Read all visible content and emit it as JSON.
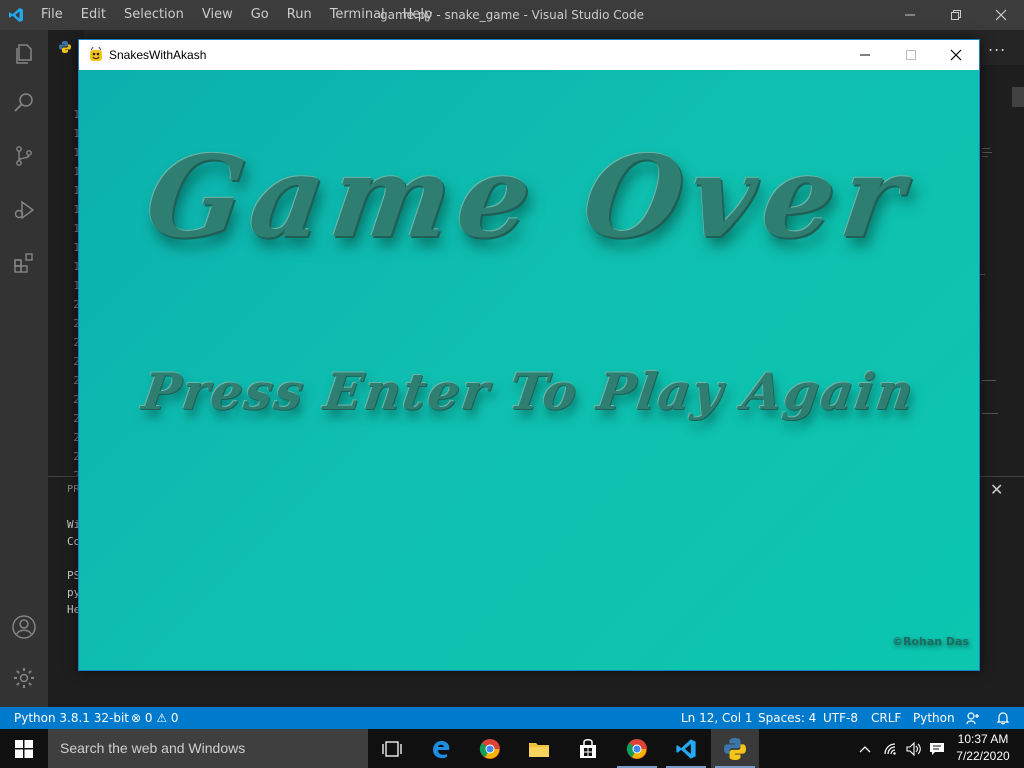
{
  "vscode": {
    "title": "game.py - snake_game - Visual Studio Code",
    "menu": [
      "File",
      "Edit",
      "Selection",
      "View",
      "Go",
      "Run",
      "Terminal",
      "Help"
    ],
    "more_actions": "...",
    "line_numbers": [
      "1",
      "1",
      "1",
      "1",
      "1",
      "1",
      "1",
      "1",
      "1",
      "1",
      "2",
      "2",
      "2",
      "2",
      "2",
      "2",
      "2",
      "2",
      "2",
      "2"
    ],
    "panel_tab_label": "PR",
    "terminal_lines": [
      "Wi",
      "Co",
      "PS",
      "py",
      "He"
    ]
  },
  "status_bar": {
    "interpreter": "Python 3.8.1 32-bit",
    "problems": "⊗ 0 ⚠ 0",
    "position": "Ln 12, Col 1",
    "spaces": "Spaces: 4",
    "encoding": "UTF-8",
    "eol": "CRLF",
    "language": "Python"
  },
  "game_window": {
    "title": "SnakesWithAkash",
    "headline": "Game Over",
    "subline": "Press Enter To Play Again",
    "credit": "©Rohan Das"
  },
  "taskbar": {
    "search_placeholder": "Search the web and Windows",
    "time": "10:37 AM",
    "date": "7/22/2020"
  },
  "colors": {
    "status_bar": "#007acc",
    "canvas_teal": "#0fbfb0",
    "text_green": "#2e7e72"
  }
}
